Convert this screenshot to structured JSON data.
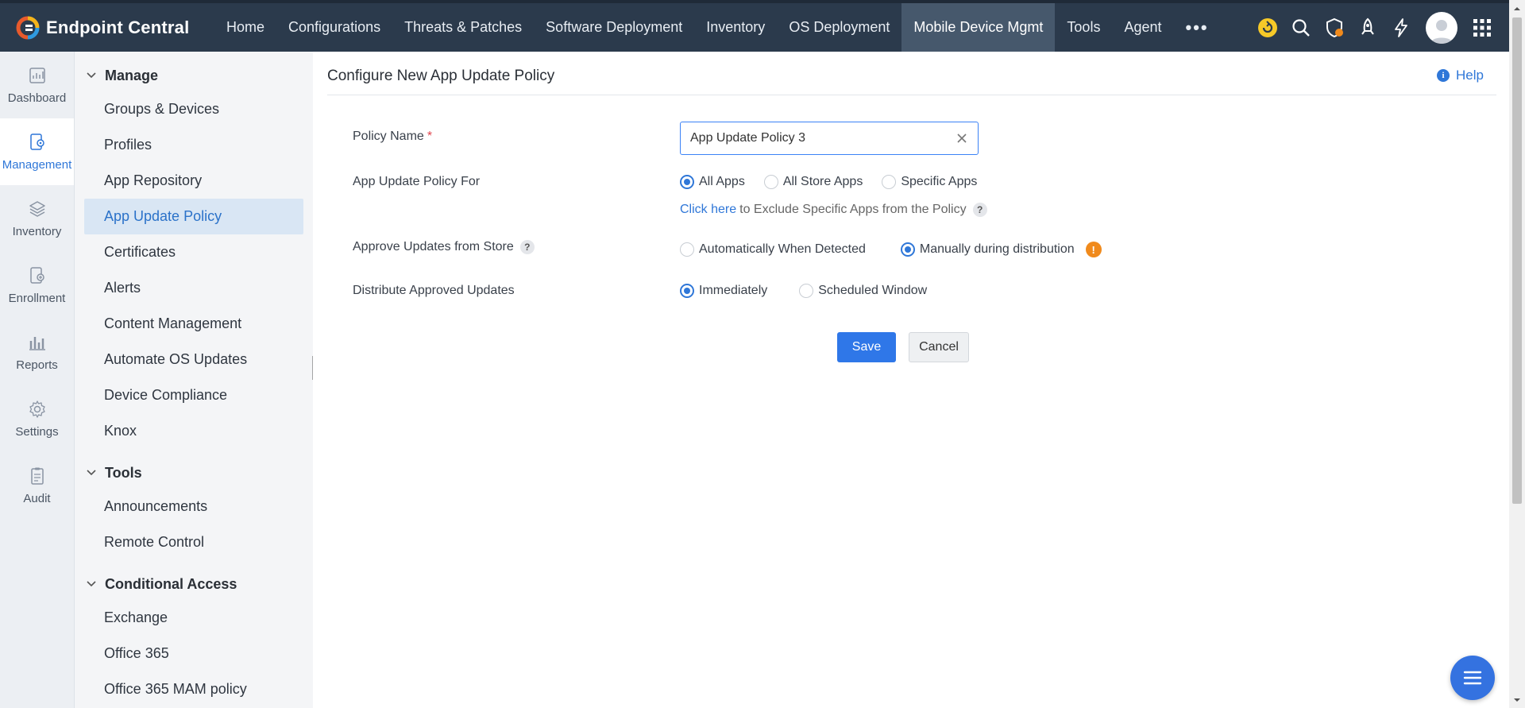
{
  "brand": {
    "name": "Endpoint Central"
  },
  "nav": {
    "items": [
      "Home",
      "Configurations",
      "Threats & Patches",
      "Software Deployment",
      "Inventory",
      "OS Deployment",
      "Mobile Device Mgmt",
      "Tools",
      "Agent"
    ],
    "active": "Mobile Device Mgmt",
    "more": "•••"
  },
  "top_icons": [
    "refresh-icon",
    "search-icon",
    "shield-icon",
    "rocket-icon",
    "lightning-icon",
    "avatar",
    "apps-grid-icon"
  ],
  "rail": {
    "items": [
      {
        "label": "Dashboard",
        "icon": "dashboard-icon"
      },
      {
        "label": "Management",
        "icon": "management-icon"
      },
      {
        "label": "Inventory",
        "icon": "inventory-icon"
      },
      {
        "label": "Enrollment",
        "icon": "enrollment-icon"
      },
      {
        "label": "Reports",
        "icon": "reports-icon"
      },
      {
        "label": "Settings",
        "icon": "settings-icon"
      },
      {
        "label": "Audit",
        "icon": "audit-icon"
      }
    ],
    "active": "Management"
  },
  "submenu": {
    "manage": {
      "title": "Manage",
      "items": [
        "Groups & Devices",
        "Profiles",
        "App Repository",
        "App Update Policy",
        "Certificates",
        "Alerts",
        "Content Management",
        "Automate OS Updates",
        "Device Compliance",
        "Knox"
      ]
    },
    "tools": {
      "title": "Tools",
      "items": [
        "Announcements",
        "Remote Control"
      ]
    },
    "conditional": {
      "title": "Conditional Access",
      "items": [
        "Exchange",
        "Office 365",
        "Office 365 MAM policy"
      ]
    },
    "active": "App Update Policy"
  },
  "page": {
    "title": "Configure New App Update Policy",
    "help": "Help"
  },
  "form": {
    "policy_name_label": "Policy Name",
    "required_mark": "*",
    "policy_name_value": "App Update Policy 3",
    "policy_for_label": "App Update Policy For",
    "policy_for_options": [
      "All Apps",
      "All Store Apps",
      "Specific Apps"
    ],
    "policy_for_selected": "All Apps",
    "exclude_link": "Click here",
    "exclude_text": "to Exclude Specific Apps from the Policy",
    "approve_label": "Approve Updates from Store",
    "approve_options": [
      "Automatically When Detected",
      "Manually during distribution"
    ],
    "approve_selected": "Manually during distribution",
    "distribute_label": "Distribute Approved Updates",
    "distribute_options": [
      "Immediately",
      "Scheduled Window"
    ],
    "distribute_selected": "Immediately",
    "save": "Save",
    "cancel": "Cancel",
    "help_mark": "?",
    "warn_mark": "!"
  },
  "colors": {
    "topbar": "#2b3a4c",
    "accent": "#2f77d8",
    "warning": "#f08a1c",
    "active_sub": "#d9e6f4"
  }
}
